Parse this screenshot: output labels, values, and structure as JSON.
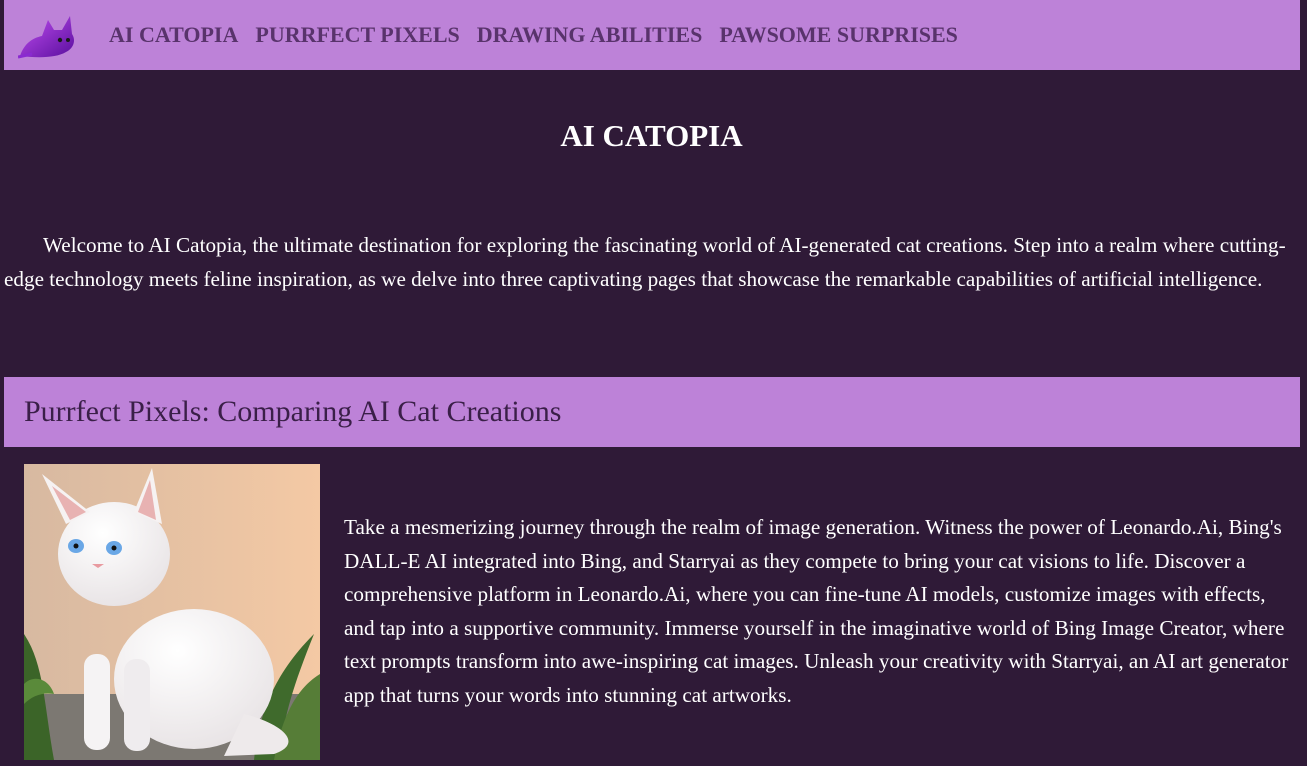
{
  "nav": {
    "logo_icon": "purple-cat-icon",
    "links": [
      {
        "label": "AI CATOPIA"
      },
      {
        "label": "PURRFECT PIXELS"
      },
      {
        "label": "DRAWING ABILITIES"
      },
      {
        "label": "PAWSOME SURPRISES"
      }
    ]
  },
  "page_title": "AI CATOPIA",
  "intro": "Welcome to AI Catopia, the ultimate destination for exploring the fascinating world of AI-generated cat creations. Step into a realm where cutting-edge technology meets feline inspiration, as we delve into three captivating pages that showcase the remarkable capabilities of artificial intelligence.",
  "section": {
    "title": "Purrfect Pixels: Comparing AI Cat Creations",
    "image_icon": "white-cat-photo",
    "text": "Take a mesmerizing journey through the realm of image generation. Witness the power of Leonardo.Ai, Bing's DALL-E AI integrated into Bing, and Starryai as they compete to bring your cat visions to life. Discover a comprehensive platform in Leonardo.Ai, where you can fine-tune AI models, customize images with effects, and tap into a supportive community. Immerse yourself in the imaginative world of Bing Image Creator, where text prompts transform into awe-inspiring cat images. Unleash your creativity with Starryai, an AI art generator app that turns your words into stunning cat artworks."
  },
  "colors": {
    "background": "#2f1a37",
    "bar": "#bd82d8",
    "nav_text": "#59336c",
    "text": "#ffffff"
  }
}
